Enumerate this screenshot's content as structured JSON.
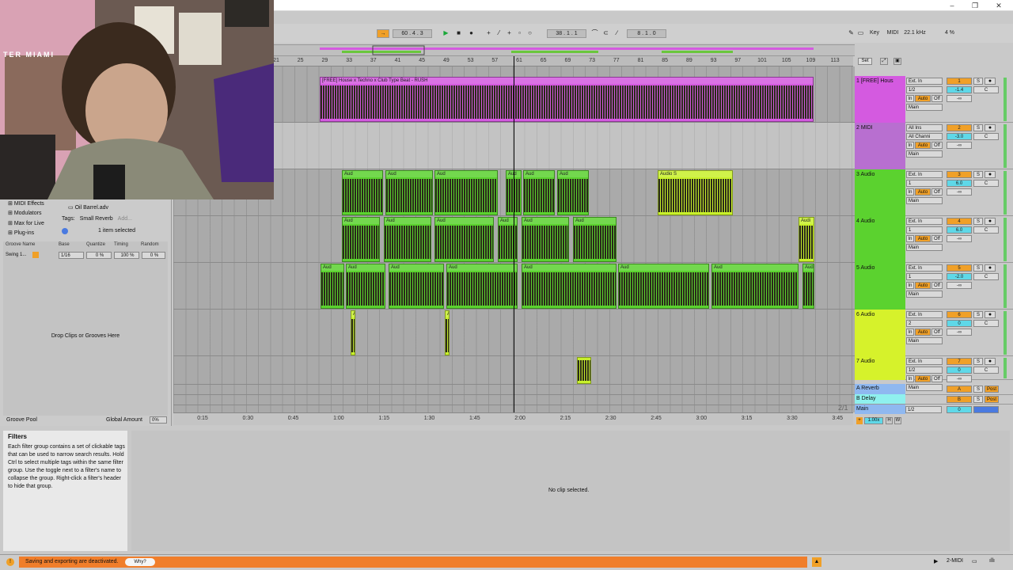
{
  "transport": {
    "tempo": "60 .  4 .  3",
    "position": "38 .  1 .  1",
    "loop_length": "8 .  1 .  0",
    "key_label": "Key",
    "midi_label": "MIDI",
    "sample_rate": "22.1 kHz",
    "cpu": "4 %"
  },
  "ruler_ticks": [
    "21",
    "25",
    "29",
    "33",
    "37",
    "41",
    "45",
    "49",
    "53",
    "57",
    "61",
    "65",
    "69",
    "73",
    "77",
    "81",
    "85",
    "89",
    "93",
    "97",
    "101",
    "105",
    "109",
    "113"
  ],
  "set_label": "Set",
  "time_ticks": [
    "0:15",
    "0:30",
    "0:45",
    "1:00",
    "1:15",
    "1:30",
    "1:45",
    "2:00",
    "2:15",
    "2:30",
    "2:45",
    "3:00",
    "3:15",
    "3:30",
    "3:45"
  ],
  "page_indicator": "2/1",
  "tracks": [
    {
      "name": "1 [FREE] Hous",
      "number": "1",
      "input": "Ext. In",
      "channel": "1/2",
      "volume": "-1.4",
      "pan": "C",
      "send": "-∞",
      "output": "Main",
      "color": "#d45ae0"
    },
    {
      "name": "2 MIDI",
      "number": "2",
      "input": "All Ins",
      "channel": "All Channi",
      "volume": "-3.0",
      "pan": "C",
      "send": "-∞",
      "output": "Main",
      "color": "#b86fd0"
    },
    {
      "name": "3 Audio",
      "number": "3",
      "input": "Ext. In",
      "channel": "1",
      "volume": "6.0",
      "pan": "C",
      "send": "-∞",
      "output": "Main",
      "color": "#5bd22f"
    },
    {
      "name": "4 Audio",
      "number": "4",
      "input": "Ext. In",
      "channel": "1",
      "volume": "6.0",
      "pan": "C",
      "send": "-∞",
      "output": "Main",
      "color": "#5bd22f"
    },
    {
      "name": "5 Audio",
      "number": "5",
      "input": "Ext. In",
      "channel": "1",
      "volume": "-2.0",
      "pan": "C",
      "send": "-∞",
      "output": "Main",
      "color": "#5bd22f"
    },
    {
      "name": "6 Audio",
      "number": "6",
      "input": "Ext. In",
      "channel": "2",
      "volume": "0",
      "pan": "C",
      "send": "-∞",
      "output": "Main",
      "color": "#d6f22b"
    },
    {
      "name": "7 Audio",
      "number": "7",
      "input": "Ext. In",
      "channel": "1/2",
      "volume": "0",
      "pan": "C",
      "send": "-∞",
      "output": "Main",
      "color": "#d6f22b"
    }
  ],
  "io": {
    "in": "In",
    "auto": "Auto",
    "off": "Off",
    "s": "S",
    "post": "Post"
  },
  "returns": [
    {
      "name": "A Reverb",
      "letter": "A",
      "color": "#8fb8f0"
    },
    {
      "name": "B Delay",
      "letter": "B",
      "color": "#8ff0ee"
    }
  ],
  "main_track": {
    "name": "Main",
    "channel": "1/2",
    "volume": "0"
  },
  "clips": {
    "track1": "[FREE] House x Techno x Club Type Beat - RUSH",
    "audio_short": "Aud",
    "audio_mid": "Audi",
    "audio_s": "Audio S"
  },
  "browser": {
    "items": [
      "MIDI Effects",
      "Modulators",
      "Max for Live",
      "Plug-ins"
    ],
    "file": "Oil Barrel.adv",
    "tags_label": "Tags:",
    "tag": "Small Reverb",
    "add": "Add...",
    "selection": "1 item selected"
  },
  "groove": {
    "headers": [
      "Groove Name",
      "Base",
      "Quantize",
      "Timing",
      "Random"
    ],
    "row": {
      "name": "Swing 1...",
      "base": "1/16",
      "quantize": "0 %",
      "timing": "100 %",
      "random": "0 %"
    },
    "drop": "Drop Clips or Grooves Here",
    "pool": "Groove Pool",
    "global_label": "Global Amount",
    "global_value": "0%"
  },
  "filters": {
    "title": "Filters",
    "body": "Each filter group contains a set of clickable tags that can be used to narrow search results. Hold Ctrl to select multiple tags within the same filter group. Use the toggle next to a filter's name to collapse the group. Right-click a filter's header to hide that group."
  },
  "detail": {
    "empty": "No clip selected."
  },
  "status": {
    "message": "Saving and exporting are deactivated.",
    "why": "Why?",
    "track": "2-MIDI"
  },
  "zoom": "1.00x",
  "webcam_text": "TER MIAMI",
  "colors": {
    "accent": "#f0a028",
    "status_bar": "#f07e2b"
  }
}
